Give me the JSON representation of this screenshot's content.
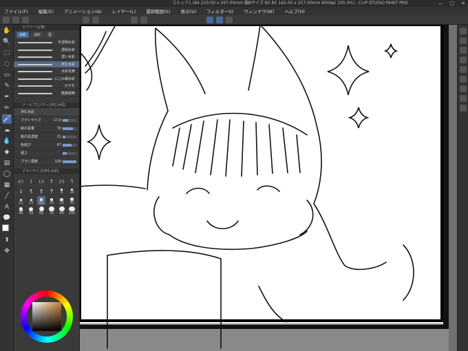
{
  "window": {
    "title": "コミック1 (B4 210.00 x 297.00mm 幅Bサイズ B5 B5 182.00 x 257.00mm 600dpi 100.0%) - CLIP STUDIO PAINT PRO",
    "controls": [
      "—",
      "□",
      "✕"
    ]
  },
  "menu": [
    "ファイル(F)",
    "編集(E)",
    "アニメーション(A)",
    "レイヤー(L)",
    "選択範囲(S)",
    "表示(V)",
    "フィルター(I)",
    "ウィンドウ(W)",
    "ヘルプ(H)"
  ],
  "tools": [
    {
      "icon": "hand-icon",
      "glyph": "✋"
    },
    {
      "icon": "zoom-icon",
      "glyph": "🔍"
    },
    {
      "icon": "select-icon",
      "glyph": "⬚"
    },
    {
      "icon": "lasso-icon",
      "glyph": "◌"
    },
    {
      "icon": "eraser-icon",
      "glyph": "▭"
    },
    {
      "icon": "eyedropper-icon",
      "glyph": "✎"
    },
    {
      "icon": "pen-icon",
      "glyph": "✒"
    },
    {
      "icon": "pencil-icon",
      "glyph": "✏"
    },
    {
      "icon": "brush-icon",
      "glyph": "🖌",
      "active": true
    },
    {
      "icon": "airbrush-icon",
      "glyph": "☁"
    },
    {
      "icon": "blend-icon",
      "glyph": "💧"
    },
    {
      "icon": "fill-icon",
      "glyph": "◆"
    },
    {
      "icon": "gradient-icon",
      "glyph": "▤"
    },
    {
      "icon": "shape-icon",
      "glyph": "◯"
    },
    {
      "icon": "frame-icon",
      "glyph": "▦"
    },
    {
      "icon": "ruler-icon",
      "glyph": "╱"
    },
    {
      "icon": "text-icon",
      "glyph": "A"
    },
    {
      "icon": "balloon-icon",
      "glyph": "💬"
    },
    {
      "icon": "line-fix-icon",
      "glyph": "⌇"
    },
    {
      "icon": "operation-icon",
      "glyph": "⬆"
    },
    {
      "icon": "move-icon",
      "glyph": "✥"
    }
  ],
  "subtool_panel": {
    "header": "サブツール[筆]",
    "tabs": [
      "水彩",
      "油彩",
      "墨"
    ],
    "active_tab": 0,
    "brushes": [
      {
        "name": "不透明水彩"
      },
      {
        "name": "透明水彩"
      },
      {
        "name": "濃い水彩"
      },
      {
        "name": "滲む水彩",
        "active": true
      },
      {
        "name": "水彩毛筆"
      },
      {
        "name": "にじみ縁水彩"
      },
      {
        "name": "かすれ"
      },
      {
        "name": "筋模様筆"
      }
    ]
  },
  "tool_property": {
    "header": "ツールプロパティ[滲む水彩]",
    "preset_label": "滲む水彩",
    "rows": [
      {
        "label": "ブラシサイズ",
        "value": "17.0",
        "fill": 0.4
      },
      {
        "label": "絵の具量",
        "value": "76",
        "fill": 0.76
      },
      {
        "label": "絵の具濃度",
        "value": "21",
        "fill": 0.21
      },
      {
        "label": "色延び",
        "value": "67",
        "fill": 0.67
      },
      {
        "label": "硬さ",
        "value": "",
        "fill": 0.3
      },
      {
        "label": "ブラシ濃度",
        "value": "100",
        "fill": 1.0
      }
    ]
  },
  "brush_size_panel": {
    "header": "ブラシサイズ[滲む水彩]",
    "sizes": [
      "0.7",
      "1",
      "1.5",
      "2",
      "2.5",
      "3",
      "4",
      "5",
      "6",
      "7",
      "8",
      "10",
      "12",
      "15",
      "17",
      "20",
      "25",
      "30",
      "40",
      "50",
      "60",
      "70",
      "80",
      "100"
    ],
    "active_size": "17"
  },
  "colors": {
    "accent": "#4a6a9a",
    "main_color": "#ffffff",
    "sub_color": "#000000"
  }
}
